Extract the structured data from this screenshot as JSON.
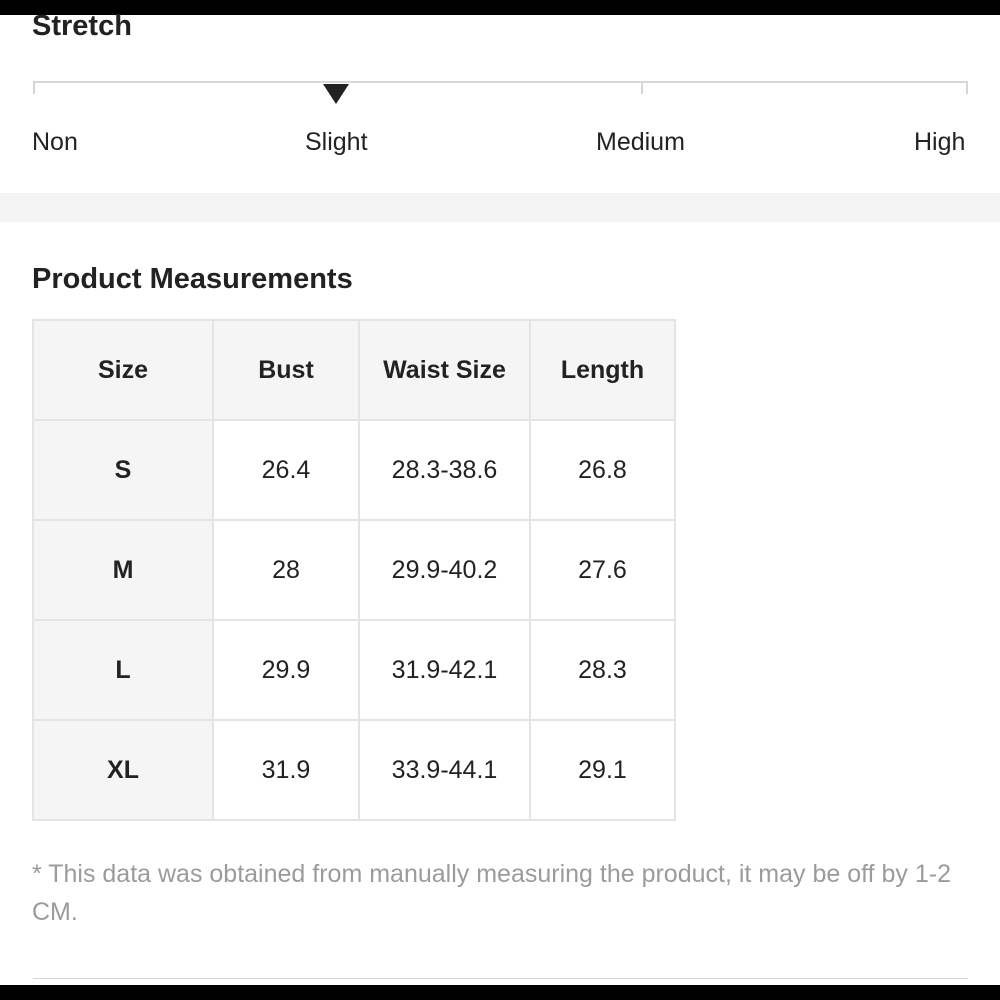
{
  "stretch": {
    "title": "Stretch",
    "levels": [
      "Non",
      "Slight",
      "Medium",
      "High"
    ],
    "selected": "Slight"
  },
  "measurements": {
    "title": "Product Measurements",
    "headers": [
      "Size",
      "Bust",
      "Waist Size",
      "Length"
    ],
    "rows": [
      [
        "S",
        "26.4",
        "28.3-38.6",
        "26.8"
      ],
      [
        "M",
        "28",
        "29.9-40.2",
        "27.6"
      ],
      [
        "L",
        "29.9",
        "31.9-42.1",
        "28.3"
      ],
      [
        "XL",
        "31.9",
        "33.9-44.1",
        "29.1"
      ]
    ],
    "note": "* This data was obtained from manually measuring the product, it may be off by 1-2 CM."
  },
  "colors": {
    "text": "#222222",
    "muted": "#9b9b9b",
    "border": "#e4e4e4",
    "header_bg": "#f5f5f5"
  },
  "icons": {
    "stretch_marker": "triangle-down-icon"
  }
}
